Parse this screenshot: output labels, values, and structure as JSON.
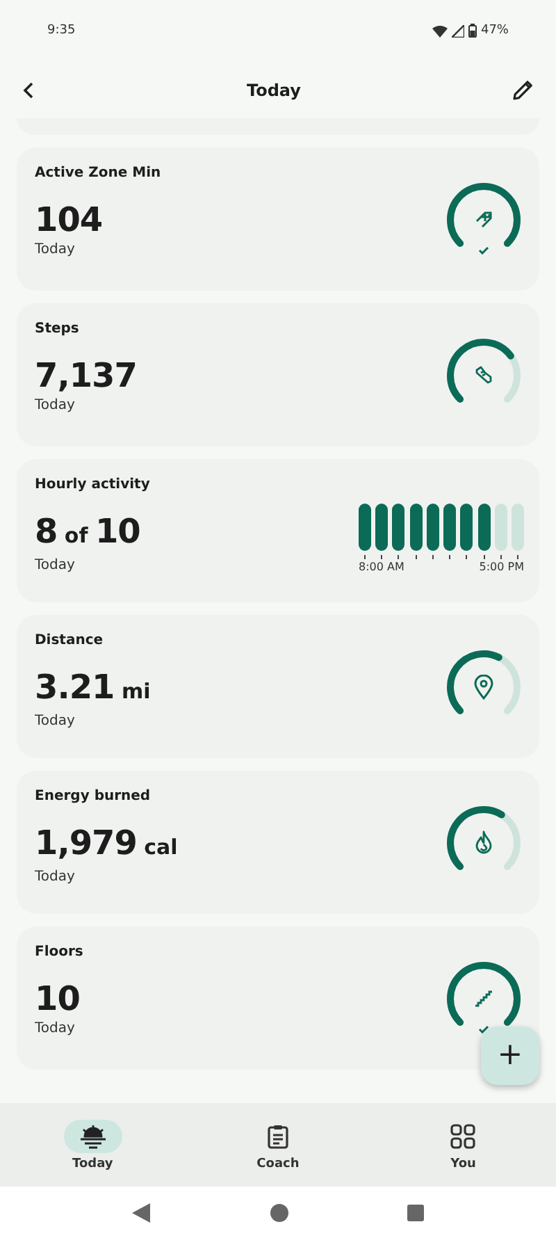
{
  "status_bar": {
    "time": "9:35",
    "battery": "47%"
  },
  "header": {
    "title": "Today"
  },
  "cards": [
    {
      "kind": "ring",
      "title": "Active Zone Min",
      "value": "104",
      "caption": "Today",
      "goal_met": true
    },
    {
      "kind": "ring",
      "title": "Steps",
      "value": "7,137",
      "caption": "Today",
      "goal_met": false
    },
    {
      "kind": "hourly",
      "title": "Hourly activity",
      "value": "8",
      "joiner": "of",
      "total": "10",
      "caption": "Today",
      "start_label": "8:00 AM",
      "end_label": "5:00 PM",
      "bars": [
        {
          "active": true
        },
        {
          "active": true
        },
        {
          "active": true
        },
        {
          "active": true
        },
        {
          "active": true
        },
        {
          "active": true
        },
        {
          "active": true
        },
        {
          "active": true
        },
        {
          "active": false
        },
        {
          "active": false
        }
      ]
    },
    {
      "kind": "ring",
      "title": "Distance",
      "value": "3.21",
      "unit": "mi",
      "caption": "Today",
      "goal_met": false
    },
    {
      "kind": "ring",
      "title": "Energy burned",
      "value": "1,979",
      "unit": "cal",
      "caption": "Today",
      "goal_met": false
    },
    {
      "kind": "ring",
      "title": "Floors",
      "value": "10",
      "caption": "Today",
      "goal_met": true
    }
  ],
  "fab": {
    "label": "+"
  },
  "nav": [
    {
      "label": "Today",
      "selected": true
    },
    {
      "label": "Coach",
      "selected": false
    },
    {
      "label": "You",
      "selected": false
    }
  ]
}
